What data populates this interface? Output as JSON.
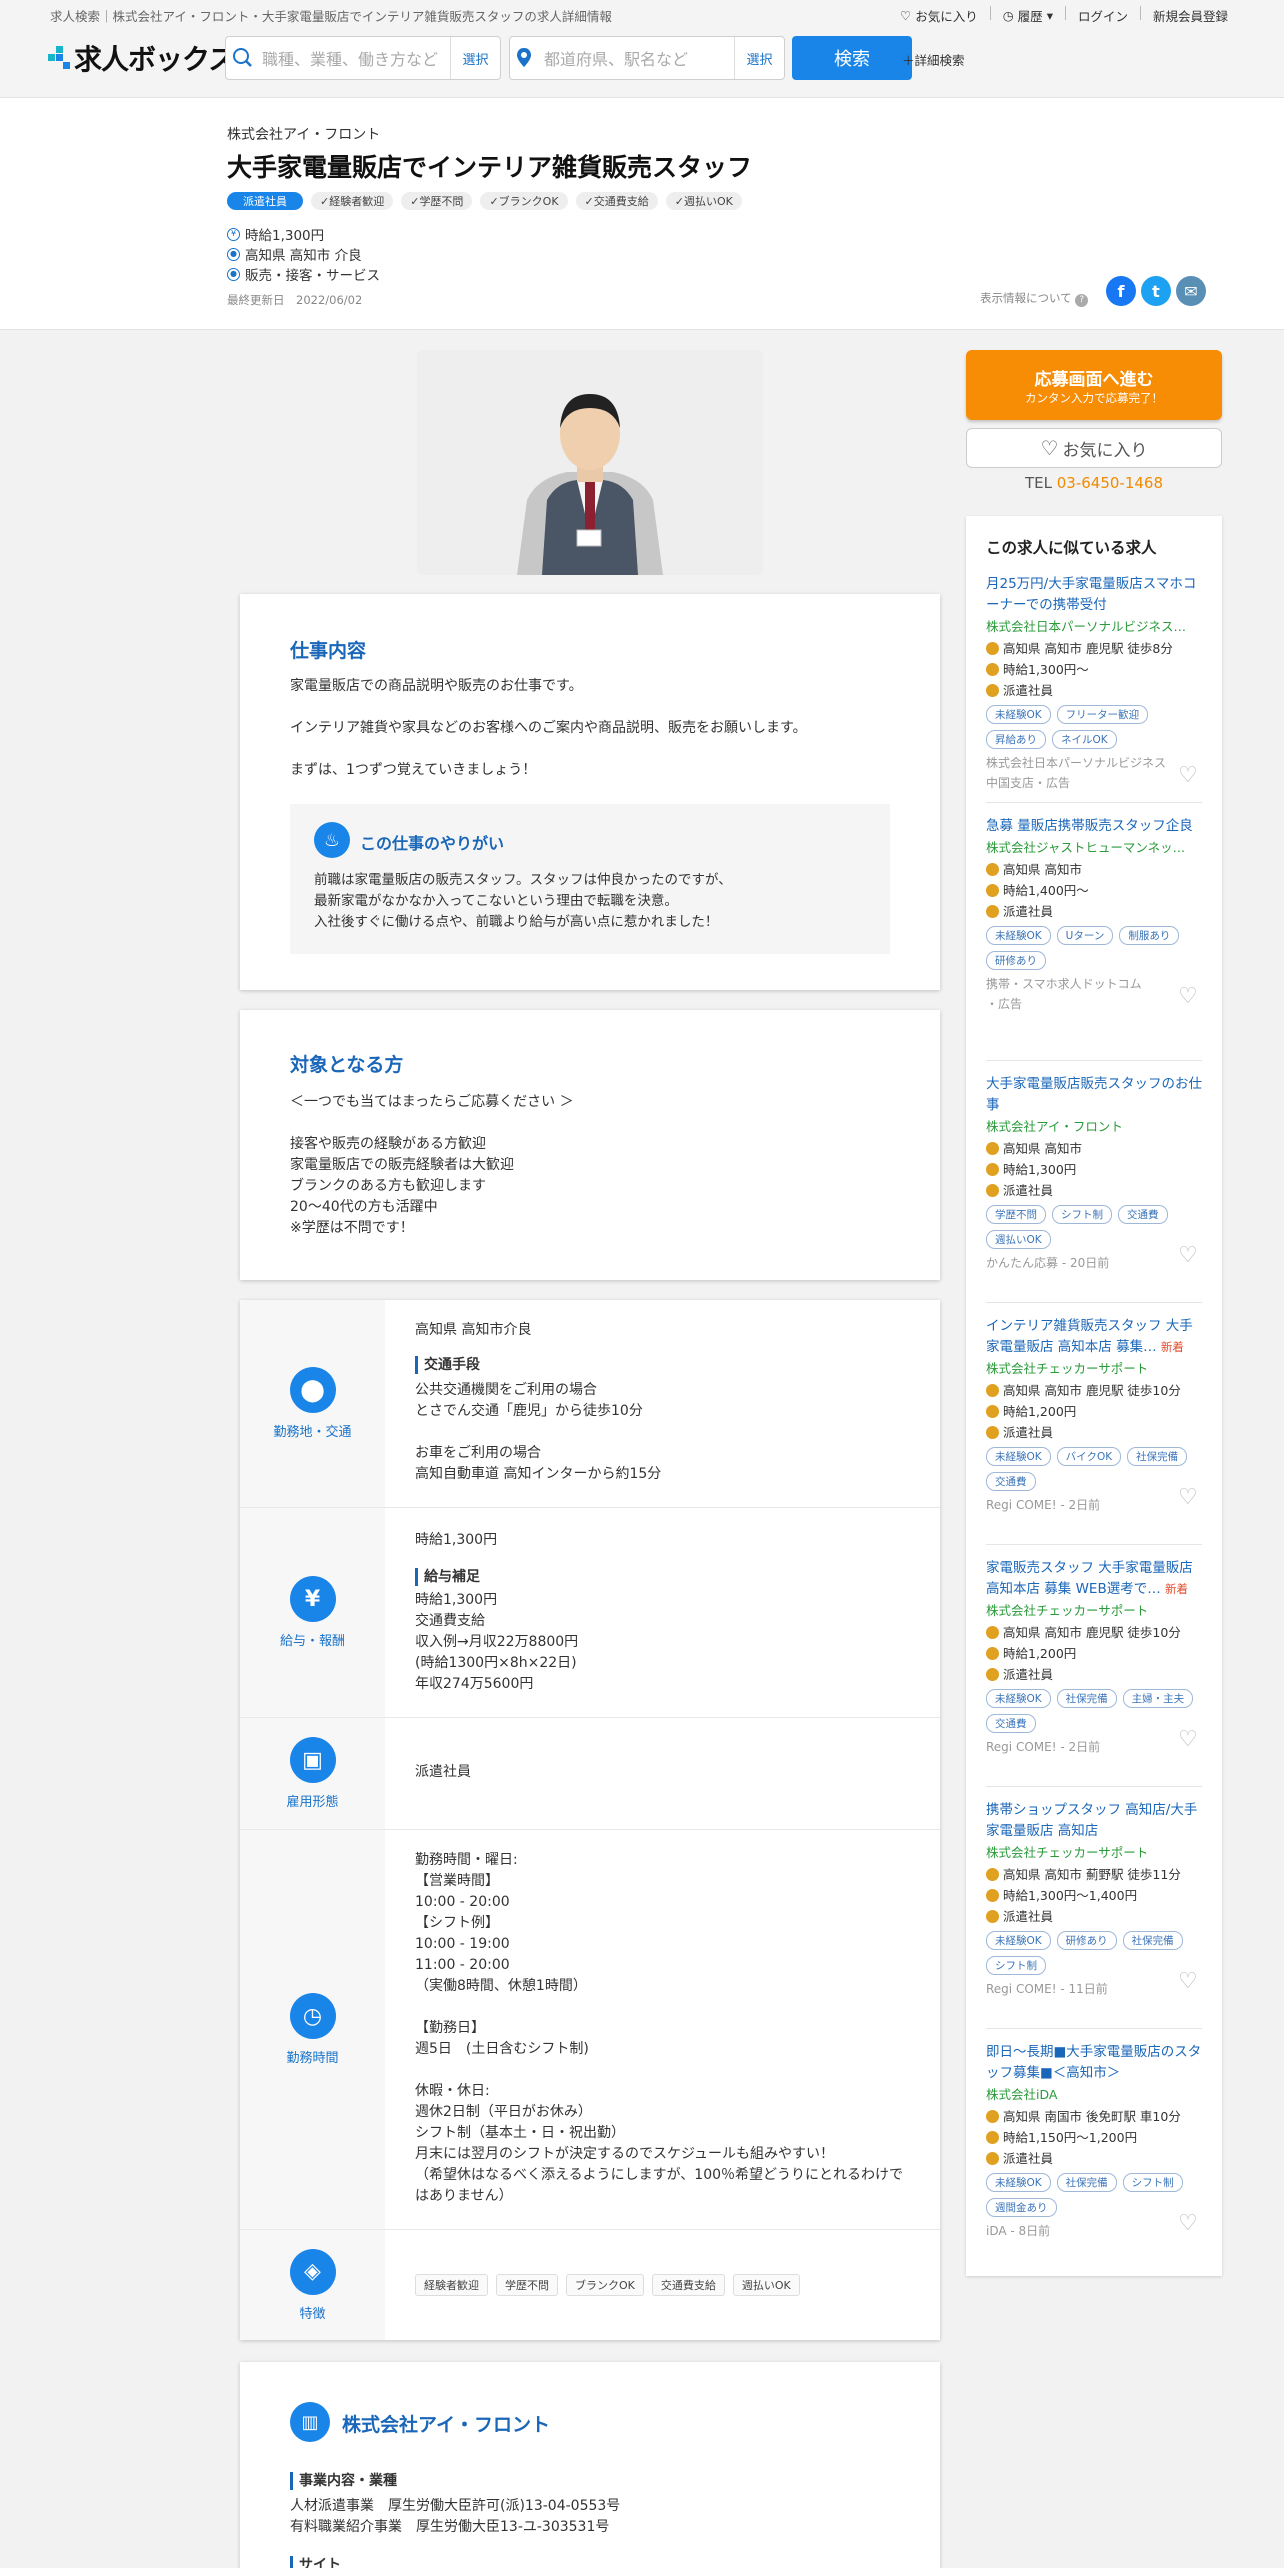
{
  "header": {
    "breadcrumb": "求人検索｜株式会社アイ・フロント・大手家電量販店でインテリア雑貨販売スタッフの求人詳細情報",
    "favorites": "お気に入り",
    "history": "履歴",
    "login": "ログイン",
    "register": "新規会員登録",
    "logo": "求人ボックス",
    "keyword_placeholder": "職種、業種、働き方など",
    "location_placeholder": "都道府県、駅名など",
    "select_label": "選択",
    "search_label": "検索",
    "advanced": "詳細検索"
  },
  "job": {
    "company": "株式会社アイ・フロント",
    "title": "大手家電量販店でインテリア雑貨販売スタッフ",
    "employment_tag": "派遣社員",
    "tags": [
      "経験者歓迎",
      "学歴不問",
      "ブランクOK",
      "交通費支給",
      "週払いOK"
    ],
    "wage": "時給1,300円",
    "location": "高知県 高知市 介良",
    "category": "販売・接客・サービス",
    "updated": "最終更新日　2022/06/02",
    "share_label": "表示情報について"
  },
  "description": {
    "heading": "仕事内容",
    "body": "家電量販店での商品説明や販売のお仕事です。\n\nインテリア雑貨や家具などのお客様へのご案内や商品説明、販売をお願いします。\n\nまずは、1つずつ覚えていきましょう！",
    "highlight_heading": "この仕事のやりがい",
    "highlight_body": "前職は家電量販店の販売スタッフ。スタッフは仲良かったのですが、\n最新家電がなかなか入ってこないという理由で転職を決意。\n入社後すぐに働ける点や、前職より給与が高い点に惹かれました！"
  },
  "target": {
    "heading": "対象となる方",
    "body": "＜一つでも当てはまったらご応募ください ＞\n\n接客や販売の経験がある方歓迎\n家電量販店での販売経験者は大歓迎\nブランクのある方も歓迎します\n20～40代の方も活躍中\n※学歴は不問です！"
  },
  "info": {
    "location_label": "勤務地・交通",
    "location_value": "高知県 高知市介良",
    "transport_heading": "交通手段",
    "transport_body": "公共交通機関をご利用の場合\nとさでん交通「鹿児」から徒歩10分\n\nお車をご利用の場合\n高知自動車道 高知インターから約15分",
    "salary_label": "給与・報酬",
    "salary_value": "時給1,300円",
    "salary_heading": "給与補足",
    "salary_body": "時給1,300円\n交通費支給\n収入例→月収22万8800円\n(時給1300円×8h×22日)\n年収274万5600円",
    "employment_label": "雇用形態",
    "employment_value": "派遣社員",
    "hours_label": "勤務時間",
    "hours_body": "勤務時間・曜日:\n【営業時間】\n10:00 - 20:00\n【シフト例】\n10:00 - 19:00\n11:00 - 20:00\n（実働8時間、休憩1時間）\n\n【勤務日】\n週5日　(土日含むシフト制)\n\n休暇・休日:\n週休2日制（平日がお休み）\nシフト制（基本土・日・祝出勤）\n月末には翌月のシフトが決定するのでスケジュールも組みやすい！\n（希望休はなるべく添えるようにしますが、100％希望どうりにとれるわけで\nはありません）",
    "features_label": "特徴",
    "features": [
      "経験者歓迎",
      "学歴不問",
      "ブランクOK",
      "交通費支給",
      "週払いOK"
    ]
  },
  "companycard": {
    "name": "株式会社アイ・フロント",
    "biz_heading": "事業内容・業種",
    "biz_body": "人材派遣事業　厚生労働大臣許可(派)13-04-0553号\n有料職業紹介事業　厚生労働大臣13-ユ-303531号",
    "site_heading": "サイト"
  },
  "sidebar": {
    "apply_main": "応募画面へ進む",
    "apply_sub": "カンタン入力で応募完了！",
    "favorite": "お気に入り",
    "tel_label": "TEL",
    "tel": "03-6450-1468",
    "similar_heading": "この求人に似ている求人",
    "items": [
      {
        "title": "月25万円/大手家電量販店スマホコーナーでの携帯受付",
        "company": "株式会社日本パーソナルビジネス…",
        "loc": "高知県 高知市 鹿児駅 徒歩8分",
        "wage": "時給1,300円～",
        "type": "派遣社員",
        "chips": [
          "未経験OK",
          "フリーター歓迎",
          "昇給あり",
          "ネイルOK"
        ],
        "src": "株式会社日本パーソナルビジネス\n中国支店・広告",
        "new": ""
      },
      {
        "title": "急募 量販店携帯販売スタッフ企良",
        "company": "株式会社ジャストヒューマンネッ…",
        "loc": "高知県 高知市",
        "wage": "時給1,400円～",
        "type": "派遣社員",
        "chips": [
          "未経験OK",
          "Uターン",
          "制服あり",
          "研修あり"
        ],
        "src": "携帯・スマホ求人ドットコム\n・広告",
        "new": ""
      },
      {
        "title": "大手家電量販店販売スタッフのお仕事",
        "company": "株式会社アイ・フロント",
        "loc": "高知県 高知市",
        "wage": "時給1,300円",
        "type": "派遣社員",
        "chips": [
          "学歴不問",
          "シフト制",
          "交通費",
          "週払いOK"
        ],
        "src": "かんたん応募 - 20日前",
        "new": ""
      },
      {
        "title": "インテリア雑貨販売スタッフ 大手家電量販店 高知本店 募集…",
        "company": "株式会社チェッカーサポート",
        "loc": "高知県 高知市 鹿児駅 徒歩10分",
        "wage": "時給1,200円",
        "type": "派遣社員",
        "chips": [
          "未経験OK",
          "バイクOK",
          "社保完備",
          "交通費"
        ],
        "src": "Regi COME! - 2日前",
        "new": "新着"
      },
      {
        "title": "家電販売スタッフ 大手家電量販店 高知本店 募集 WEB選考で…",
        "company": "株式会社チェッカーサポート",
        "loc": "高知県 高知市 鹿児駅 徒歩10分",
        "wage": "時給1,200円",
        "type": "派遣社員",
        "chips": [
          "未経験OK",
          "社保完備",
          "主婦・主夫",
          "交通費"
        ],
        "src": "Regi COME! - 2日前",
        "new": "新着"
      },
      {
        "title": "携帯ショップスタッフ 高知店/大手家電量販店 高知店",
        "company": "株式会社チェッカーサポート",
        "loc": "高知県 高知市 薊野駅 徒歩11分",
        "wage": "時給1,300円～1,400円",
        "type": "派遣社員",
        "chips": [
          "未経験OK",
          "研修あり",
          "社保完備",
          "シフト制"
        ],
        "src": "Regi COME! - 11日前",
        "new": ""
      },
      {
        "title": "即日～長期■大手家電量販店のスタッフ募集■＜高知市＞",
        "company": "株式会社iDA",
        "loc": "高知県 南国市 後免町駅 車10分",
        "wage": "時給1,150円～1,200円",
        "type": "派遣社員",
        "chips": [
          "未経験OK",
          "社保完備",
          "シフト制",
          "週間金あり"
        ],
        "src": "iDA - 8日前",
        "new": ""
      }
    ]
  }
}
